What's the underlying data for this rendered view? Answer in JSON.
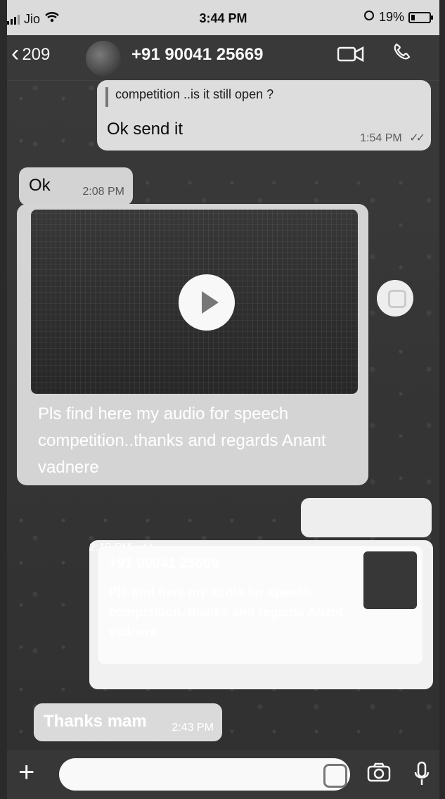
{
  "status_bar": {
    "carrier": "Jio",
    "time": "3:44 PM",
    "battery_percent": "19%",
    "battery_level": 0.19
  },
  "header": {
    "back_count": "209",
    "contact_name": "+91 90041 25669",
    "icons": [
      "back-chevron-icon",
      "video-call-icon",
      "phone-call-icon"
    ]
  },
  "messages": {
    "m1": {
      "reply_preview": "competition ..is it still open ?",
      "text": "Ok send it",
      "time": "1:54 PM"
    },
    "m2": {
      "text": "Ok",
      "time": "2:08 PM"
    },
    "m3": {
      "caption": "Pls find here my audio for speech competition..thanks and regards Anant vadnere"
    },
    "m4": {
      "quoted_sender": "+91 90041 25669",
      "quoted_text": "Pls find here my audio for speech competition..thanks and regards Anant vadnere",
      "time": "2:12 PM"
    },
    "m5": {
      "text": "Thanks mam",
      "time": "2:43 PM"
    }
  },
  "input": {
    "placeholder": ""
  }
}
